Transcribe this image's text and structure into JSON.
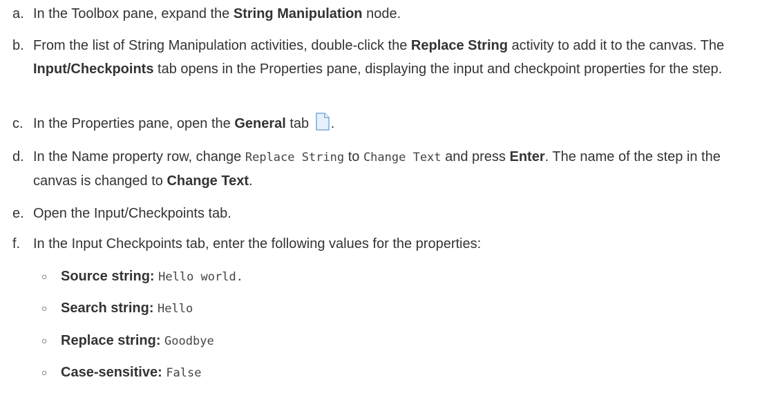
{
  "steps": [
    {
      "marker": "a.",
      "t1": "In the Toolbox pane, expand the ",
      "b1": "String Manipulation",
      "t2": " node."
    },
    {
      "marker": "b.",
      "t1": "From the list of String Manipulation activities, double-click the ",
      "b1": "Replace String",
      "t2": " activity to add it to the canvas. The ",
      "b2": "Input/Checkpoints",
      "t3": " tab opens in the Properties pane, displaying the input and checkpoint properties for the step."
    },
    {
      "marker": "c.",
      "t1": "In the Properties pane, open the ",
      "b1": "General",
      "t2": " tab ",
      "icon": "document-icon",
      "t3": "."
    },
    {
      "marker": "d.",
      "t1": "In the Name property row, change ",
      "code1": "Replace String",
      "t2": " to ",
      "code2": "Change Text",
      "t3": " and press ",
      "b1": "Enter",
      "t4": ". The name of the step in the canvas is changed to ",
      "b2": "Change Text",
      "t5": "."
    },
    {
      "marker": "e.",
      "t1": "Open the Input/Checkpoints tab."
    },
    {
      "marker": "f.",
      "t1": "In the Input Checkpoints tab, enter the following values for the properties:"
    }
  ],
  "properties": [
    {
      "label": "Source string:",
      "value": "Hello world."
    },
    {
      "label": "Search string:",
      "value": "Hello"
    },
    {
      "label": "Replace string:",
      "value": "Goodbye"
    },
    {
      "label": "Case-sensitive:",
      "value": "False"
    }
  ],
  "bullet_glyph": "○",
  "colors": {
    "text": "#333333",
    "code": "#444444",
    "icon_border": "#7aa7d9",
    "icon_fill": "#e8f1fb"
  }
}
